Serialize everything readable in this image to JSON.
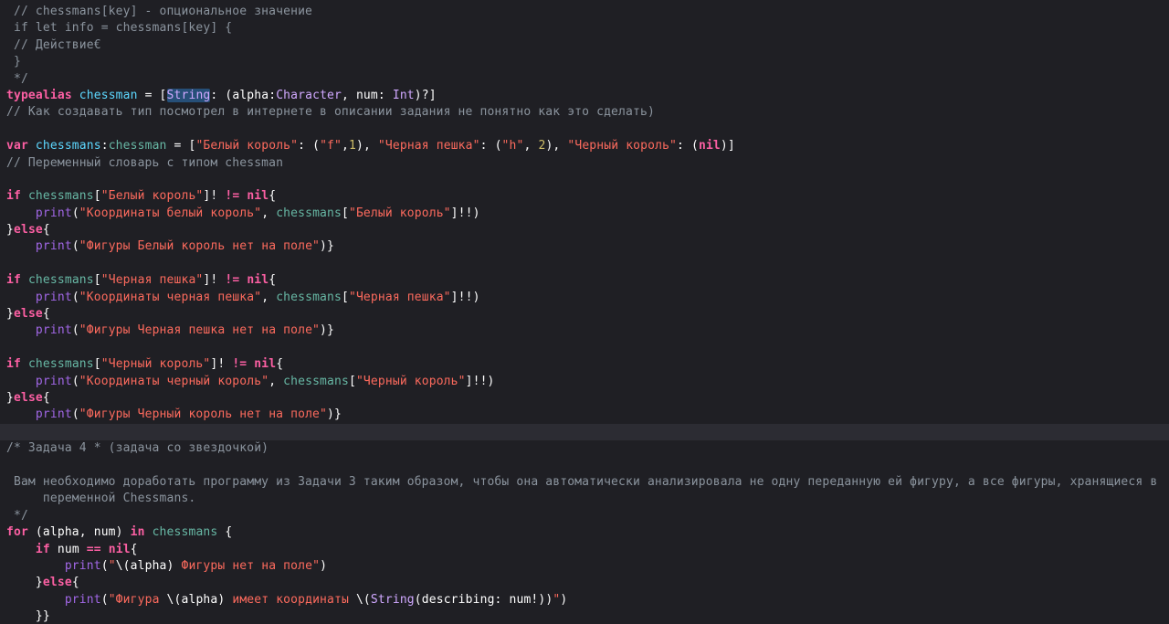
{
  "editor": {
    "language": "Swift",
    "theme_colors": {
      "background": "#1f1f24",
      "current_line": "#2c2c33",
      "comment": "#8b949e",
      "keyword": "#fc5fa3",
      "string": "#fc6a5d",
      "number": "#d0bf69",
      "type": "#d0a8ff",
      "declaration": "#5dd8ff",
      "project_symbol": "#67b7a4",
      "builtin_function": "#a167e6",
      "selection": "#264f78"
    },
    "current_line_index": 25,
    "lines": [
      [
        {
          "t": " // chessmans[key] - опциональное значение",
          "k": "comment"
        }
      ],
      [
        {
          "t": " if let info = chessmans[key] {",
          "k": "comment"
        }
      ],
      [
        {
          "t": " // Действие€",
          "k": "comment"
        }
      ],
      [
        {
          "t": " }",
          "k": "comment"
        }
      ],
      [
        {
          "t": " */",
          "k": "comment"
        }
      ],
      [
        {
          "t": "typealias",
          "k": "keyword"
        },
        {
          "t": " ",
          "k": "plain"
        },
        {
          "t": "chessman",
          "k": "typedecl"
        },
        {
          "t": " = [",
          "k": "plain"
        },
        {
          "t": "String",
          "k": "type",
          "sel": true
        },
        {
          "t": ": (alpha:",
          "k": "plain"
        },
        {
          "t": "Character",
          "k": "type"
        },
        {
          "t": ", num: ",
          "k": "plain"
        },
        {
          "t": "Int",
          "k": "type"
        },
        {
          "t": ")?]",
          "k": "plain"
        }
      ],
      [
        {
          "t": "// Как создавать тип посмотрел в интернете в описании задания не понятно как это сделать)",
          "k": "comment"
        }
      ],
      [],
      [
        {
          "t": "var",
          "k": "keyword"
        },
        {
          "t": " ",
          "k": "plain"
        },
        {
          "t": "chessmans",
          "k": "typedecl"
        },
        {
          "t": ":",
          "k": "plain"
        },
        {
          "t": "chessman",
          "k": "project"
        },
        {
          "t": " = [",
          "k": "plain"
        },
        {
          "t": "\"Белый король\"",
          "k": "string"
        },
        {
          "t": ": (",
          "k": "plain"
        },
        {
          "t": "\"f\"",
          "k": "string"
        },
        {
          "t": ",",
          "k": "plain"
        },
        {
          "t": "1",
          "k": "number"
        },
        {
          "t": "), ",
          "k": "plain"
        },
        {
          "t": "\"Черная пешка\"",
          "k": "string"
        },
        {
          "t": ": (",
          "k": "plain"
        },
        {
          "t": "\"h\"",
          "k": "string"
        },
        {
          "t": ", ",
          "k": "plain"
        },
        {
          "t": "2",
          "k": "number"
        },
        {
          "t": "), ",
          "k": "plain"
        },
        {
          "t": "\"Черный король\"",
          "k": "string"
        },
        {
          "t": ": (",
          "k": "plain"
        },
        {
          "t": "nil",
          "k": "keyword"
        },
        {
          "t": ")]",
          "k": "plain"
        }
      ],
      [
        {
          "t": "// Переменный словарь с типом chessman",
          "k": "comment"
        }
      ],
      [],
      [
        {
          "t": "if",
          "k": "keyword"
        },
        {
          "t": " ",
          "k": "plain"
        },
        {
          "t": "chessmans",
          "k": "project"
        },
        {
          "t": "[",
          "k": "plain"
        },
        {
          "t": "\"Белый король\"",
          "k": "string"
        },
        {
          "t": "]! ",
          "k": "plain"
        },
        {
          "t": "!=",
          "k": "keyword"
        },
        {
          "t": " ",
          "k": "plain"
        },
        {
          "t": "nil",
          "k": "keyword"
        },
        {
          "t": "{",
          "k": "plain"
        }
      ],
      [
        {
          "t": "    ",
          "k": "plain"
        },
        {
          "t": "print",
          "k": "builtin"
        },
        {
          "t": "(",
          "k": "plain"
        },
        {
          "t": "\"Координаты белый король\"",
          "k": "string"
        },
        {
          "t": ", ",
          "k": "plain"
        },
        {
          "t": "chessmans",
          "k": "project"
        },
        {
          "t": "[",
          "k": "plain"
        },
        {
          "t": "\"Белый король\"",
          "k": "string"
        },
        {
          "t": "]!!)",
          "k": "plain"
        }
      ],
      [
        {
          "t": "}",
          "k": "plain"
        },
        {
          "t": "else",
          "k": "keyword"
        },
        {
          "t": "{",
          "k": "plain"
        }
      ],
      [
        {
          "t": "    ",
          "k": "plain"
        },
        {
          "t": "print",
          "k": "builtin"
        },
        {
          "t": "(",
          "k": "plain"
        },
        {
          "t": "\"Фигуры Белый король нет на поле\"",
          "k": "string"
        },
        {
          "t": ")}",
          "k": "plain"
        }
      ],
      [],
      [
        {
          "t": "if",
          "k": "keyword"
        },
        {
          "t": " ",
          "k": "plain"
        },
        {
          "t": "chessmans",
          "k": "project"
        },
        {
          "t": "[",
          "k": "plain"
        },
        {
          "t": "\"Черная пешка\"",
          "k": "string"
        },
        {
          "t": "]! ",
          "k": "plain"
        },
        {
          "t": "!=",
          "k": "keyword"
        },
        {
          "t": " ",
          "k": "plain"
        },
        {
          "t": "nil",
          "k": "keyword"
        },
        {
          "t": "{",
          "k": "plain"
        }
      ],
      [
        {
          "t": "    ",
          "k": "plain"
        },
        {
          "t": "print",
          "k": "builtin"
        },
        {
          "t": "(",
          "k": "plain"
        },
        {
          "t": "\"Координаты черная пешка\"",
          "k": "string"
        },
        {
          "t": ", ",
          "k": "plain"
        },
        {
          "t": "chessmans",
          "k": "project"
        },
        {
          "t": "[",
          "k": "plain"
        },
        {
          "t": "\"Черная пешка\"",
          "k": "string"
        },
        {
          "t": "]!!)",
          "k": "plain"
        }
      ],
      [
        {
          "t": "}",
          "k": "plain"
        },
        {
          "t": "else",
          "k": "keyword"
        },
        {
          "t": "{",
          "k": "plain"
        }
      ],
      [
        {
          "t": "    ",
          "k": "plain"
        },
        {
          "t": "print",
          "k": "builtin"
        },
        {
          "t": "(",
          "k": "plain"
        },
        {
          "t": "\"Фигуры Черная пешка нет на поле\"",
          "k": "string"
        },
        {
          "t": ")}",
          "k": "plain"
        }
      ],
      [],
      [
        {
          "t": "if",
          "k": "keyword"
        },
        {
          "t": " ",
          "k": "plain"
        },
        {
          "t": "chessmans",
          "k": "project"
        },
        {
          "t": "[",
          "k": "plain"
        },
        {
          "t": "\"Черный король\"",
          "k": "string"
        },
        {
          "t": "]! ",
          "k": "plain"
        },
        {
          "t": "!=",
          "k": "keyword"
        },
        {
          "t": " ",
          "k": "plain"
        },
        {
          "t": "nil",
          "k": "keyword"
        },
        {
          "t": "{",
          "k": "plain"
        }
      ],
      [
        {
          "t": "    ",
          "k": "plain"
        },
        {
          "t": "print",
          "k": "builtin"
        },
        {
          "t": "(",
          "k": "plain"
        },
        {
          "t": "\"Координаты черный король\"",
          "k": "string"
        },
        {
          "t": ", ",
          "k": "plain"
        },
        {
          "t": "chessmans",
          "k": "project"
        },
        {
          "t": "[",
          "k": "plain"
        },
        {
          "t": "\"Черный король\"",
          "k": "string"
        },
        {
          "t": "]!!)",
          "k": "plain"
        }
      ],
      [
        {
          "t": "}",
          "k": "plain"
        },
        {
          "t": "else",
          "k": "keyword"
        },
        {
          "t": "{",
          "k": "plain"
        }
      ],
      [
        {
          "t": "    ",
          "k": "plain"
        },
        {
          "t": "print",
          "k": "builtin"
        },
        {
          "t": "(",
          "k": "plain"
        },
        {
          "t": "\"Фигуры Черный король нет на поле\"",
          "k": "string"
        },
        {
          "t": ")}",
          "k": "plain"
        }
      ],
      [],
      [
        {
          "t": "/* Задача 4 * (задача со звездочкой)",
          "k": "comment"
        }
      ],
      [],
      [
        {
          "t": " Вам необходимо доработать программу из Задачи 3 таким образом, чтобы она автоматически анализировала не одну переданную ей фигуру, а все фигуры, хранящиеся в",
          "k": "comment"
        }
      ],
      [
        {
          "t": "     переменной Chessmans.",
          "k": "comment"
        }
      ],
      [
        {
          "t": " */",
          "k": "comment"
        }
      ],
      [
        {
          "t": "for",
          "k": "keyword"
        },
        {
          "t": " (alpha, num) ",
          "k": "plain"
        },
        {
          "t": "in",
          "k": "keyword"
        },
        {
          "t": " ",
          "k": "plain"
        },
        {
          "t": "chessmans",
          "k": "project"
        },
        {
          "t": " {",
          "k": "plain"
        }
      ],
      [
        {
          "t": "    ",
          "k": "plain"
        },
        {
          "t": "if",
          "k": "keyword"
        },
        {
          "t": " num ",
          "k": "plain"
        },
        {
          "t": "==",
          "k": "keyword"
        },
        {
          "t": " ",
          "k": "plain"
        },
        {
          "t": "nil",
          "k": "keyword"
        },
        {
          "t": "{",
          "k": "plain"
        }
      ],
      [
        {
          "t": "        ",
          "k": "plain"
        },
        {
          "t": "print",
          "k": "builtin"
        },
        {
          "t": "(",
          "k": "plain"
        },
        {
          "t": "\"",
          "k": "string"
        },
        {
          "t": "\\(alpha)",
          "k": "plain"
        },
        {
          "t": " Фигуры нет на поле\"",
          "k": "string"
        },
        {
          "t": ")",
          "k": "plain"
        }
      ],
      [
        {
          "t": "    }",
          "k": "plain"
        },
        {
          "t": "else",
          "k": "keyword"
        },
        {
          "t": "{",
          "k": "plain"
        }
      ],
      [
        {
          "t": "        ",
          "k": "plain"
        },
        {
          "t": "print",
          "k": "builtin"
        },
        {
          "t": "(",
          "k": "plain"
        },
        {
          "t": "\"Фигура ",
          "k": "string"
        },
        {
          "t": "\\(alpha)",
          "k": "plain"
        },
        {
          "t": " имеет координаты ",
          "k": "string"
        },
        {
          "t": "\\(",
          "k": "plain"
        },
        {
          "t": "String",
          "k": "type"
        },
        {
          "t": "(describing: num!))",
          "k": "plain"
        },
        {
          "t": "\"",
          "k": "string"
        },
        {
          "t": ")",
          "k": "plain"
        }
      ],
      [
        {
          "t": "    }}",
          "k": "plain"
        }
      ]
    ]
  }
}
